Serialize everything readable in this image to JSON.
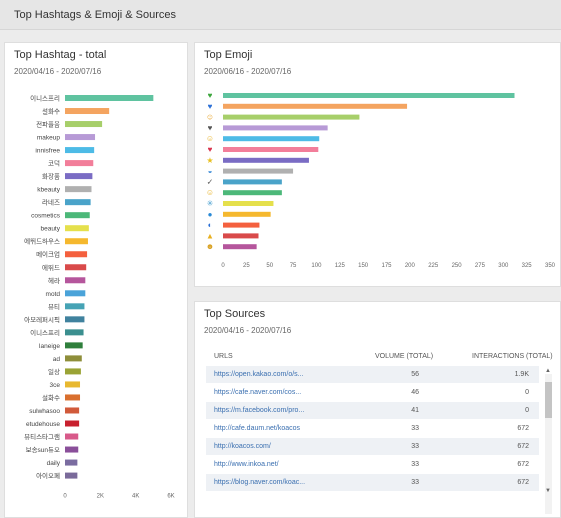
{
  "header": {
    "title": "Top Hashtags & Emoji & Sources"
  },
  "hashtags": {
    "title": "Top Hashtag - total",
    "date_range": "2020/04/16 - 2020/07/16"
  },
  "emoji": {
    "title": "Top Emoji",
    "date_range": "2020/06/16 - 2020/07/16"
  },
  "sources": {
    "title": "Top Sources",
    "date_range": "2020/04/16 - 2020/07/16",
    "columns": {
      "urls": "URLS",
      "volume": "VOLUME (TOTAL)",
      "interactions": "INTERACTIONS (TOTAL)"
    },
    "rows": [
      {
        "url": "https://open.kakao.com/o/s...",
        "volume": "56",
        "interactions": "1.9K"
      },
      {
        "url": "https://cafe.naver.com/cos...",
        "volume": "46",
        "interactions": "0"
      },
      {
        "url": "https://m.facebook.com/pro...",
        "volume": "41",
        "interactions": "0"
      },
      {
        "url": "http://cafe.daum.net/koacos",
        "volume": "33",
        "interactions": "672"
      },
      {
        "url": "http://koacos.com/",
        "volume": "33",
        "interactions": "672"
      },
      {
        "url": "http://www.inkoa.net/",
        "volume": "33",
        "interactions": "672"
      },
      {
        "url": "https://blog.naver.com/koac...",
        "volume": "33",
        "interactions": "672"
      }
    ]
  },
  "chart_data": [
    {
      "type": "bar",
      "orientation": "horizontal",
      "title": "Top Hashtag - total",
      "categories": [
        "이니스프리",
        "설화수",
        "전파플음",
        "makeup",
        "innisfree",
        "코덕",
        "화장품",
        "kbeauty",
        "라네즈",
        "cosmetics",
        "beauty",
        "에뛰드하우스",
        "메이크업",
        "에뛰드",
        "헤라",
        "motd",
        "뷰티",
        "아모레퍼시픽",
        "이니스프리",
        "laneige",
        "ad",
        "일상",
        "3ce",
        "설화수",
        "sulwhasoo",
        "etudehouse",
        "뷰티스타그램",
        "보송sun듀오",
        "daily",
        "아이오페"
      ],
      "values": [
        5000,
        2500,
        2100,
        1700,
        1650,
        1600,
        1550,
        1500,
        1450,
        1400,
        1350,
        1300,
        1250,
        1200,
        1150,
        1150,
        1100,
        1100,
        1050,
        1000,
        950,
        900,
        850,
        850,
        800,
        800,
        750,
        750,
        700,
        700
      ],
      "colors": [
        "#5fc3a0",
        "#f4a460",
        "#a7cf6a",
        "#b79ad6",
        "#4dbbe6",
        "#f27e9a",
        "#7a6cc4",
        "#b0b0b0",
        "#4aa3c9",
        "#4cb879",
        "#e5e04c",
        "#f5b82e",
        "#f4603e",
        "#d94a4a",
        "#b5569c",
        "#4aa3d9",
        "#46a3b5",
        "#40829e",
        "#3b8f8f",
        "#2f7f3c",
        "#8e8e3a",
        "#9aa335",
        "#e8b82f",
        "#d96f2e",
        "#d15a3a",
        "#c8202e",
        "#d85a8a",
        "#8a4f9a",
        "#7a6ca0",
        "#7a6a9a"
      ],
      "xlim": [
        0,
        6000
      ],
      "xticks": [
        "0",
        "2K",
        "4K",
        "6K"
      ]
    },
    {
      "type": "bar",
      "orientation": "horizontal",
      "title": "Top Emoji",
      "categories": [
        "green-heart-emoji",
        "blue-heart-emoji",
        "smiling-face-emoji",
        "black-heart-emoji",
        "smiling-face-2-emoji",
        "red-heart-emoji",
        "sparkles-emoji",
        "rainbow-emoji",
        "check-mark-emoji",
        "grinning-face-emoji",
        "sparkle-emoji",
        "droplet-emoji",
        "wave-emoji",
        "thumbs-up-emoji",
        "smile-emoji"
      ],
      "values": [
        312,
        197,
        146,
        112,
        103,
        102,
        92,
        75,
        63,
        63,
        54,
        51,
        39,
        38,
        36
      ],
      "colors": [
        "#5fc3a0",
        "#f4a460",
        "#a7cf6a",
        "#b79ad6",
        "#4dbbe6",
        "#f27e9a",
        "#7a6cc4",
        "#b0b0b0",
        "#4aa3c9",
        "#4cb879",
        "#e5e04c",
        "#f5b82e",
        "#f4603e",
        "#d94a4a",
        "#b5569c"
      ],
      "xlim": [
        0,
        350
      ],
      "xticks": [
        "0",
        "25",
        "50",
        "75",
        "100",
        "125",
        "150",
        "175",
        "200",
        "225",
        "250",
        "275",
        "300",
        "325",
        "350"
      ]
    }
  ]
}
